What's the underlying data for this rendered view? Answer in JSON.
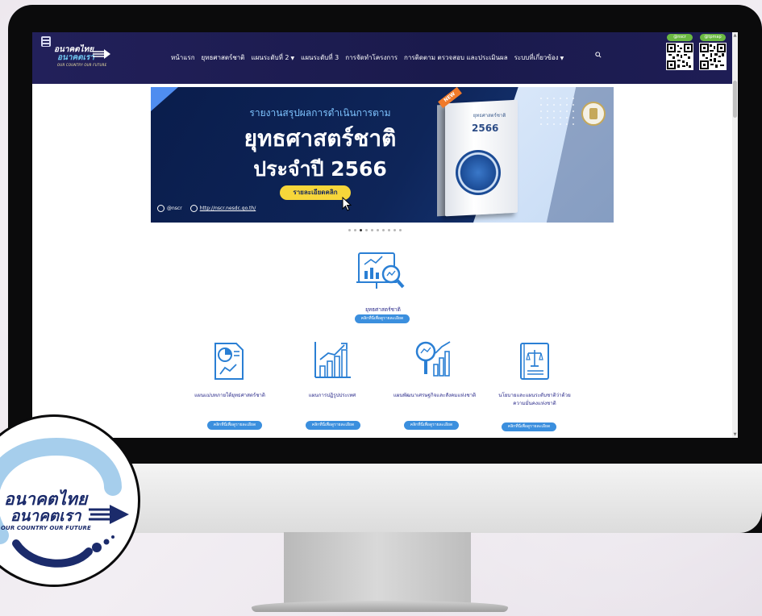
{
  "nav": {
    "logo": {
      "line1": "อนาคตไทย",
      "line2": "อนาคตเรา",
      "line3": "OUR COUNTRY OUR FUTURE"
    },
    "links": [
      {
        "label": "หน้าแรก",
        "dropdown": false
      },
      {
        "label": "ยุทธศาสตร์ชาติ",
        "dropdown": false
      },
      {
        "label": "แผนระดับที่ 2",
        "dropdown": true
      },
      {
        "label": "แผนระดับที่ 3",
        "dropdown": false
      },
      {
        "label": "การจัดทำโครงการ",
        "dropdown": false
      },
      {
        "label": "การติดตาม ตรวจสอบ และประเมินผล",
        "dropdown": false
      },
      {
        "label": "ระบบที่เกี่ยวข้อง",
        "dropdown": true
      }
    ],
    "qr_codes": [
      {
        "label": "@nscr"
      },
      {
        "label": "@tpmap"
      }
    ],
    "chevron_glyph": "⌄"
  },
  "banner": {
    "line1": "รายงานสรุปผลการดำเนินการตาม",
    "line2": "ยุทธศาสตร์ชาติ",
    "line3": "ประจำปี 2566",
    "button": "รายละเอียดคลิก",
    "badge": "NEW",
    "book_title": "ยุทธศาสตร์ชาติ",
    "book_year": "2566",
    "footer_handle": "@nscr",
    "footer_url": "http://nscr.nesdc.go.th/"
  },
  "carousel": {
    "count": 10,
    "active_index": 2
  },
  "main_section": {
    "label": "ยุทธศาสตร์ชาติ",
    "button": "คลิกที่นี่เพื่อดูรายละเอียด"
  },
  "cards": [
    {
      "label": "แผนแม่บทภายใต้ยุทธศาสตร์ชาติ",
      "button": "คลิกที่นี่เพื่อดูรายละเอียด",
      "icon": "document-chart-icon"
    },
    {
      "label": "แผนการปฏิรูปประเทศ",
      "button": "คลิกที่นี่เพื่อดูรายละเอียด",
      "icon": "bar-growth-icon"
    },
    {
      "label": "แผนพัฒนาเศรษฐกิจและสังคมแห่งชาติ",
      "button": "คลิกที่นี่เพื่อดูรายละเอียด",
      "icon": "magnify-chart-icon"
    },
    {
      "label": "นโยบายและแผนระดับชาติว่าด้วยความมั่นคงแห่งชาติ",
      "button": "คลิกที่นี่เพื่อดูรายละเอียด",
      "icon": "law-book-icon"
    }
  ],
  "overlay_logo": {
    "line1": "อนาคตไทย",
    "line2": "อนาคตเรา",
    "line3": "OUR COUNTRY OUR FUTURE"
  },
  "colors": {
    "nav_bg": "#22205a",
    "accent_blue": "#3b8fde",
    "banner_bg": "#0e2559",
    "button_yellow": "#f7d63a",
    "label_text": "#2a2a8a"
  }
}
